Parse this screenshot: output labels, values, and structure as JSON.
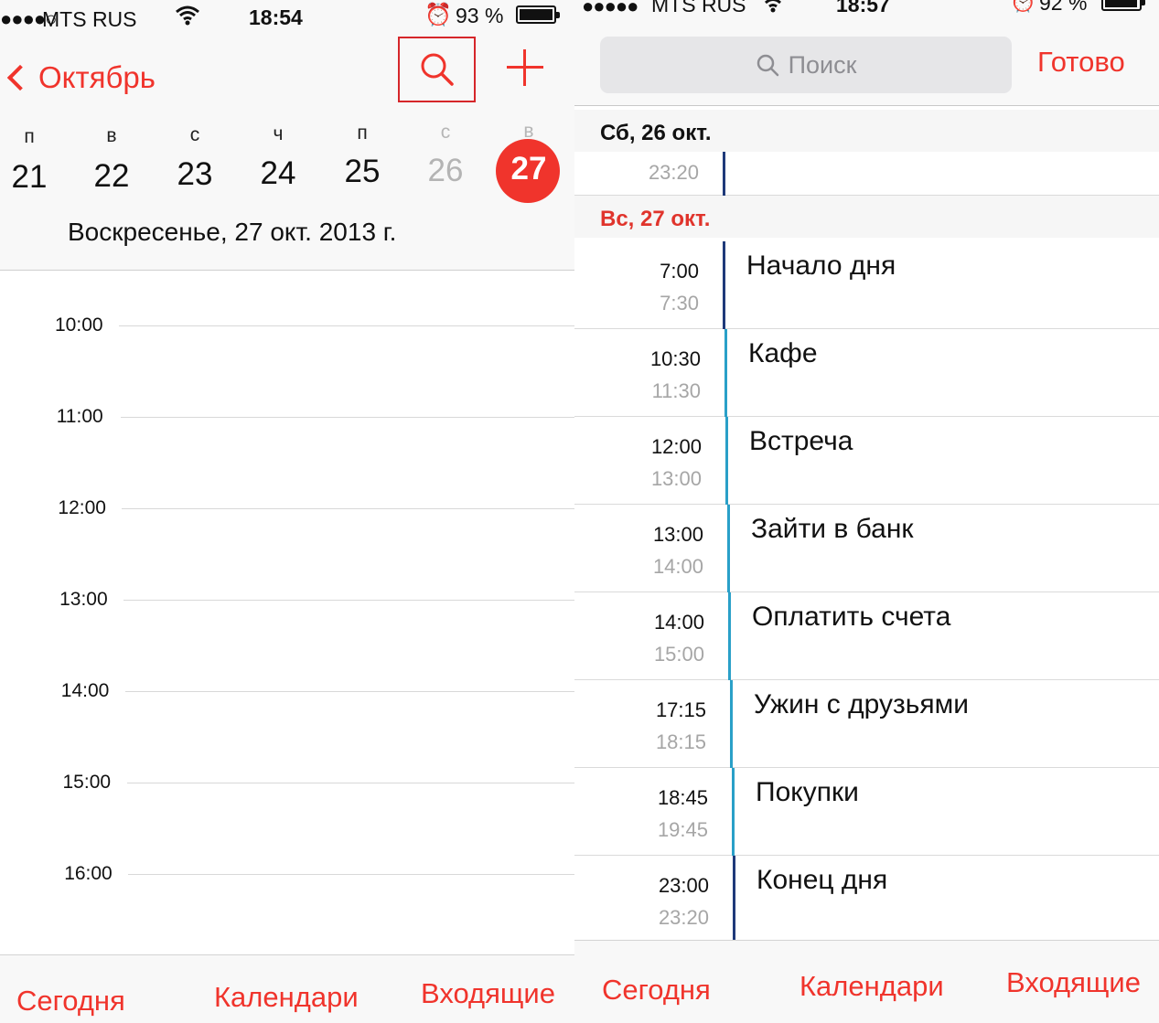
{
  "left": {
    "status": {
      "signal": "●●●●○",
      "carrier": "MTS RUS",
      "time": "18:54",
      "battery": "93 %"
    },
    "header": {
      "back_label": "Октябрь"
    },
    "week": {
      "letters": [
        "п",
        "в",
        "с",
        "ч",
        "п",
        "с",
        "в"
      ],
      "days": [
        "21",
        "22",
        "23",
        "24",
        "25",
        "26",
        "27"
      ],
      "selected_index": 6
    },
    "day_title": "Воскресенье, 27 окт. 2013 г.",
    "hours": [
      "10:00",
      "11:00",
      "12:00",
      "13:00",
      "14:00",
      "15:00",
      "16:00"
    ],
    "tabs": [
      "Сегодня",
      "Календари",
      "Входящие"
    ]
  },
  "right": {
    "status": {
      "signal": "●●●●●",
      "carrier": "MTS RUS",
      "time": "18:57",
      "battery": "92 %"
    },
    "search": {
      "placeholder": "Поиск",
      "done_label": "Готово"
    },
    "sections": [
      {
        "label": "Сб, 26 окт.",
        "color": "#111111",
        "events": [
          {
            "start": "",
            "end": "23:20",
            "title": ""
          }
        ]
      },
      {
        "label": "Вс, 27 окт.",
        "color": "#e0342c",
        "events": [
          {
            "start": "7:00",
            "end": "7:30",
            "title": "Начало дня"
          },
          {
            "start": "10:30",
            "end": "11:30",
            "title": "Кафе"
          },
          {
            "start": "12:00",
            "end": "13:00",
            "title": "Встреча"
          },
          {
            "start": "13:00",
            "end": "14:00",
            "title": "Зайти в банк"
          },
          {
            "start": "14:00",
            "end": "15:00",
            "title": "Оплатить счета"
          },
          {
            "start": "17:15",
            "end": "18:15",
            "title": "Ужин с друзьями"
          },
          {
            "start": "18:45",
            "end": "19:45",
            "title": "Покупки"
          },
          {
            "start": "23:00",
            "end": "23:20",
            "title": "Конец дня"
          }
        ]
      }
    ],
    "tabs": [
      "Сегодня",
      "Календари",
      "Входящие"
    ]
  },
  "colors": {
    "accent": "#f0342c",
    "bar_dark": "#1f3a7a",
    "bar_light": "#2aa0c8",
    "grey_text": "#a6a6a6"
  }
}
